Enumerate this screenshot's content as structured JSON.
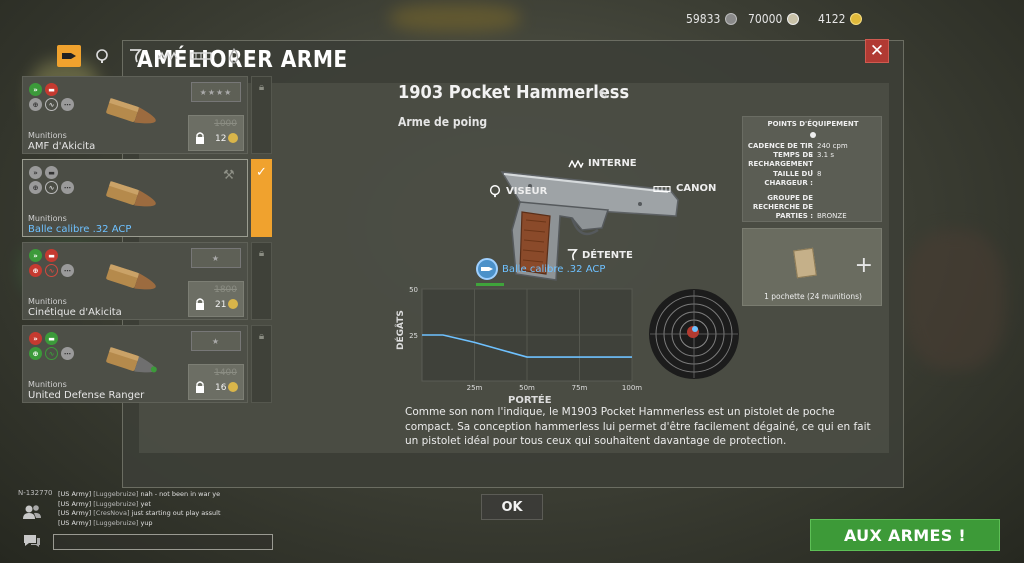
{
  "topbar": {
    "resources": [
      {
        "value": "59833",
        "icon": "silver-coin-icon",
        "color": "#9a9a9a"
      },
      {
        "value": "70000",
        "icon": "medal-icon",
        "color": "#d7d2c0"
      },
      {
        "value": "4122",
        "icon": "gold-coin-icon",
        "color": "#e0b93b"
      }
    ]
  },
  "modal": {
    "title": "AMÉLIORER ARME",
    "close_label": "✕"
  },
  "filters": [
    {
      "icon": "ammo-icon",
      "glyph": "▬",
      "active": true
    },
    {
      "icon": "scope-icon",
      "glyph": "◎",
      "active": false
    },
    {
      "icon": "trigger-icon",
      "glyph": "ʔ",
      "active": false
    },
    {
      "icon": "spring-icon",
      "glyph": "ʍʍ",
      "active": false
    },
    {
      "icon": "barrel-icon",
      "glyph": "═",
      "active": false
    },
    {
      "icon": "flame-icon",
      "glyph": "♨",
      "active": false
    }
  ],
  "ammo": [
    {
      "category": "Munitions",
      "name": "AMF d'Akicita",
      "cost_old": "1000",
      "cost": "12",
      "selected": false,
      "stars": "★★★★"
    },
    {
      "category": "Munitions",
      "name": "Balle calibre .32 ACP",
      "cost_old": "",
      "cost": "",
      "selected": true,
      "stars": ""
    },
    {
      "category": "Munitions",
      "name": "Cinétique d'Akicita",
      "cost_old": "1800",
      "cost": "21",
      "selected": false,
      "stars": "★"
    },
    {
      "category": "Munitions",
      "name": "United Defense Ranger",
      "cost_old": "1400",
      "cost": "16",
      "selected": false,
      "stars": "★"
    }
  ],
  "weapon": {
    "name": "1903 Pocket Hammerless",
    "type": "Arme de poing",
    "parts": {
      "interne": "INTERNE",
      "viseur": "VISEUR",
      "canon": "CANON",
      "detente": "DÉTENTE"
    },
    "current_ammo": "Balle calibre .32 ACP",
    "description": "Comme son nom l'indique, le M1903 Pocket Hammerless est un pistolet de poche compact. Sa conception hammerless lui permet d'être facilement dégainé, ce qui en fait un pistolet idéal pour tous ceux qui souhaitent davantage de protection."
  },
  "chart_data": {
    "type": "line",
    "ylabel": "DÉGÂTS",
    "xlabel": "PORTÉE",
    "x_ticks": [
      "25m",
      "50m",
      "75m",
      "100m"
    ],
    "y_ticks": [
      "50",
      "25"
    ],
    "ylim": [
      0,
      50
    ],
    "xlim": [
      0,
      100
    ],
    "series": [
      {
        "x": [
          0,
          10,
          25,
          50,
          75,
          100
        ],
        "y": [
          25,
          25,
          21,
          13,
          13,
          13
        ]
      }
    ],
    "grid": true
  },
  "stats": {
    "title": "POINTS D'ÉQUIPEMENT",
    "rows": [
      {
        "label": "CADENCE DE TIR :",
        "value": "240 cpm"
      },
      {
        "label": "TEMPS DE",
        "value": "3.1 s"
      },
      {
        "label": "RECHARGEMENT :",
        "value": ""
      },
      {
        "label": "TAILLE DU",
        "value": "8"
      },
      {
        "label": "CHARGEUR :",
        "value": ""
      },
      {
        "label": "GROUPE DE",
        "value": ""
      },
      {
        "label": "RECHERCHE DE",
        "value": ""
      },
      {
        "label": "PARTIES :",
        "value": "BRONZE"
      }
    ]
  },
  "pouch": {
    "label": "1 pochette (24 munitions)",
    "plus": "+"
  },
  "buttons": {
    "ok": "OK",
    "aux_armes": "AUX ARMES !"
  },
  "chat": {
    "id": "N-132770",
    "lines": [
      {
        "prefix": "[US Army]",
        "nick": "[Luggebruize]",
        "text": "nah - not been in war ye"
      },
      {
        "prefix": "[US Army]",
        "nick": "[Luggebruize]",
        "text": "yet"
      },
      {
        "prefix": "[US Army]",
        "nick": "[CresNova]",
        "text": "just starting out play assult"
      },
      {
        "prefix": "[US Army]",
        "nick": "[Luggebruize]",
        "text": "yup"
      }
    ]
  }
}
